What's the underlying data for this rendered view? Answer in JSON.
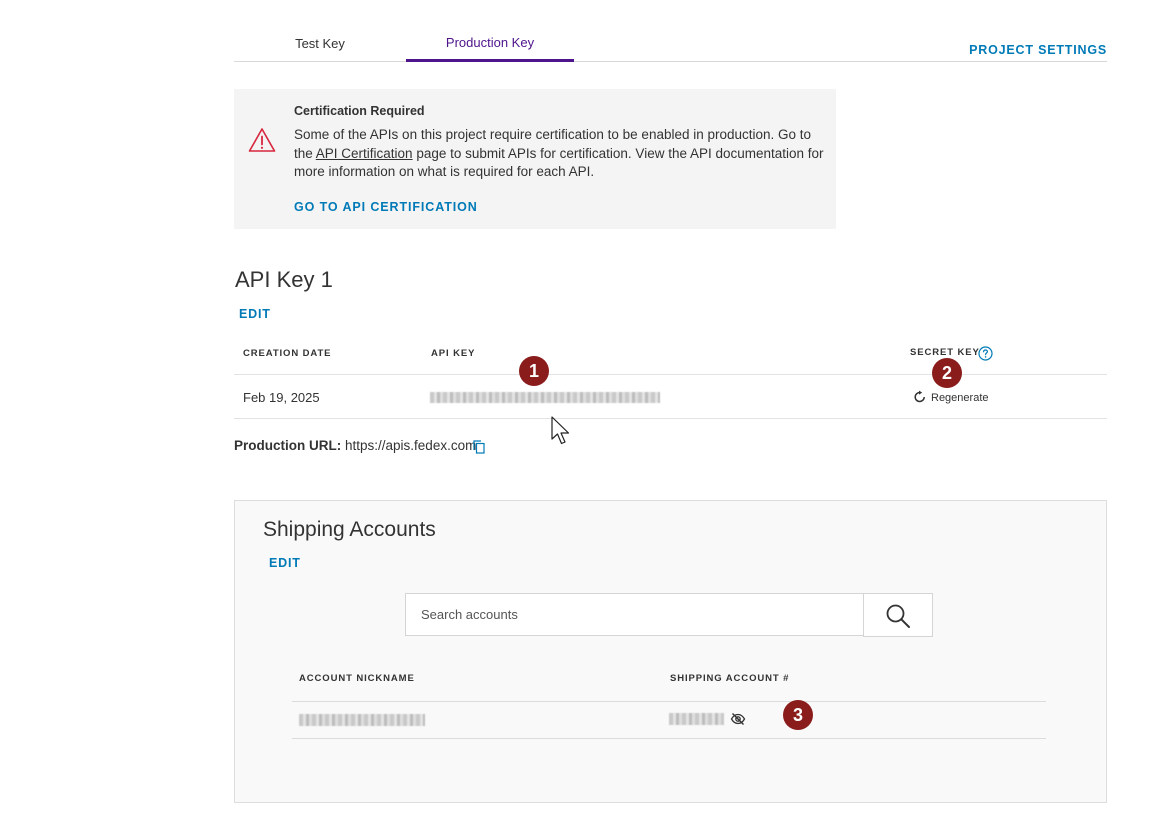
{
  "tabs": [
    {
      "label": "Test Key",
      "active": false
    },
    {
      "label": "Production Key",
      "active": true
    }
  ],
  "header": {
    "project_settings": "PROJECT SETTINGS"
  },
  "certification": {
    "icon": "warning-icon",
    "title": "Certification Required",
    "body_part1": "Some of the APIs on this project require certification to be enabled in production. Go to the ",
    "body_link": "API Certification",
    "body_part2": " page to submit APIs for certification. View the API documentation for more information on what is required for each API.",
    "action": "GO TO API CERTIFICATION"
  },
  "api_key": {
    "title": "API Key 1",
    "edit": "EDIT",
    "columns": {
      "creation_date": "CREATION DATE",
      "api_key": "API KEY",
      "secret_key": "SECRET KEY"
    },
    "row": {
      "creation_date": "Feb 19, 2025",
      "regenerate": "Regenerate"
    }
  },
  "production_url": {
    "label": "Production URL:",
    "value": "https://apis.fedex.com"
  },
  "shipping_accounts": {
    "title": "Shipping Accounts",
    "edit": "EDIT",
    "search_placeholder": "Search accounts",
    "columns": {
      "nickname": "ACCOUNT NICKNAME",
      "account_number": "SHIPPING ACCOUNT #"
    }
  },
  "annotations": [
    "1",
    "2",
    "3"
  ],
  "colors": {
    "brand_purple": "#4d148c",
    "link_blue": "#007ab7",
    "warning_red": "#d7263d",
    "badge_red": "#8a1c1c"
  }
}
